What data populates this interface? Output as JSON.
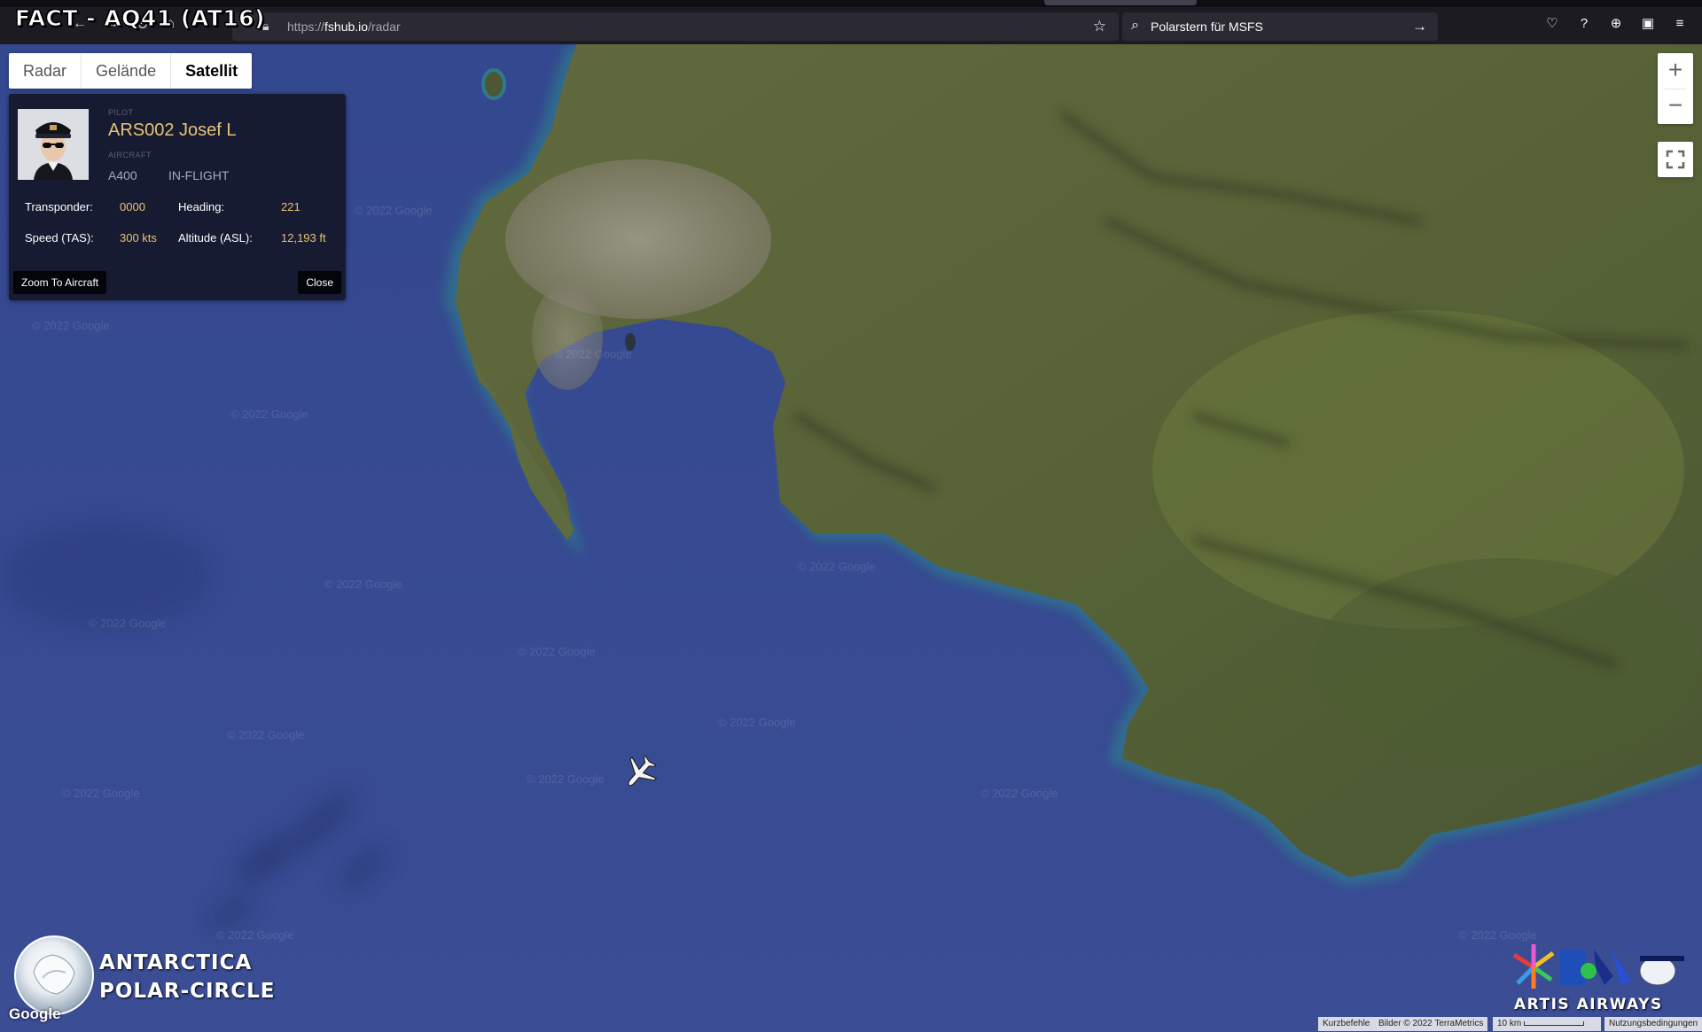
{
  "overlay": {
    "title": "FACT - AQ41 (AT16)"
  },
  "browser": {
    "url_scheme": "https://",
    "url_host": "fshub.io",
    "url_path": "/radar",
    "search_text": "Polarstern für MSFS"
  },
  "map_types": [
    {
      "label": "Radar",
      "active": false
    },
    {
      "label": "Gelände",
      "active": false
    },
    {
      "label": "Satellit",
      "active": true
    }
  ],
  "pilot_panel": {
    "pilot_label": "PILOT",
    "pilot_name": "ARS002 Josef L",
    "aircraft_label": "AIRCRAFT",
    "aircraft_type": "A400",
    "flight_status": "IN-FLIGHT",
    "transponder_label": "Transponder:",
    "transponder_value": "0000",
    "heading_label": "Heading:",
    "heading_value": "221",
    "speed_label": "Speed (TAS):",
    "speed_value": "300 kts",
    "altitude_label": "Altitude (ASL):",
    "altitude_value": "12,193 ft",
    "zoom_button": "Zoom To Aircraft",
    "close_button": "Close"
  },
  "map": {
    "watermark": "© 2022 Google",
    "google_logo": "Google",
    "zoom_in": "+",
    "zoom_out": "−"
  },
  "branding": {
    "left_line1": "ANTARCTICA",
    "left_line2": "POLAR-CIRCLE",
    "right_text": "ARTIS AIRWAYS"
  },
  "attribution": {
    "shortcuts": "Kurzbefehle",
    "imagery": "Bilder © 2022 TerraMetrics",
    "scale": "10 km",
    "terms": "Nutzungsbedingungen"
  },
  "colors": {
    "ocean": "#33478f",
    "land": "#5f6b3c",
    "panel_bg": "#14182c",
    "panel_accent": "#e8c276"
  }
}
